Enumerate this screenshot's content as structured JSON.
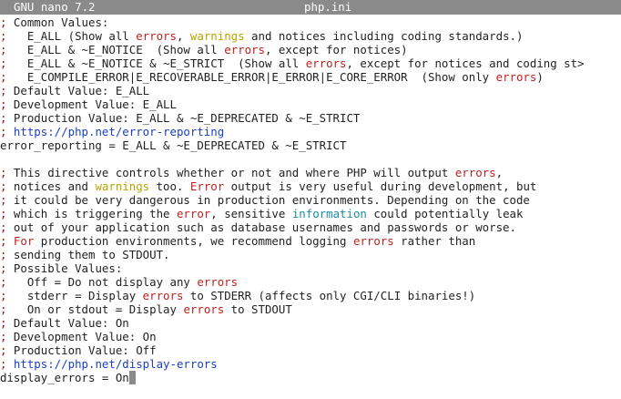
{
  "window": {
    "app_title": "GNU nano 7.2",
    "file_name": "php.ini"
  },
  "colors": {
    "titlebar_bg": "#8a8a8a",
    "comment_marker": "#a00c0c",
    "keyword_red": "#c0201f",
    "keyword_yellow": "#b8a400",
    "keyword_cyan": "#1a8fa0",
    "url_blue": "#1a3fc4"
  },
  "editor": {
    "lines": [
      [
        {
          "t": ";",
          "c": "marker"
        },
        {
          "t": " Common Values:",
          "c": "comment"
        }
      ],
      [
        {
          "t": ";",
          "c": "marker"
        },
        {
          "t": "   E_ALL (Show all ",
          "c": "comment"
        },
        {
          "t": "errors",
          "c": "red"
        },
        {
          "t": ", ",
          "c": "comment"
        },
        {
          "t": "warnings",
          "c": "yellow"
        },
        {
          "t": " and notices including coding standards.)",
          "c": "comment"
        }
      ],
      [
        {
          "t": ";",
          "c": "marker"
        },
        {
          "t": "   E_ALL & ~E_NOTICE  (Show all ",
          "c": "comment"
        },
        {
          "t": "errors",
          "c": "red"
        },
        {
          "t": ", except for notices)",
          "c": "comment"
        }
      ],
      [
        {
          "t": ";",
          "c": "marker"
        },
        {
          "t": "   E_ALL & ~E_NOTICE & ~E_STRICT  (Show all ",
          "c": "comment"
        },
        {
          "t": "errors",
          "c": "red"
        },
        {
          "t": ", except for notices and coding st",
          "c": "comment"
        },
        {
          "t": ">",
          "c": "bar"
        }
      ],
      [
        {
          "t": ";",
          "c": "marker"
        },
        {
          "t": "   E_COMPILE_ERROR|E_RECOVERABLE_ERROR|E_ERROR|E_CORE_ERROR  (Show only ",
          "c": "comment"
        },
        {
          "t": "errors",
          "c": "red"
        },
        {
          "t": ")",
          "c": "comment"
        }
      ],
      [
        {
          "t": ";",
          "c": "marker"
        },
        {
          "t": " Default Value: E_ALL",
          "c": "comment"
        }
      ],
      [
        {
          "t": ";",
          "c": "marker"
        },
        {
          "t": " Development Value: E_ALL",
          "c": "comment"
        }
      ],
      [
        {
          "t": ";",
          "c": "marker"
        },
        {
          "t": " Production Value: E_ALL & ~E_DEPRECATED & ~E_STRICT",
          "c": "comment"
        }
      ],
      [
        {
          "t": ";",
          "c": "marker"
        },
        {
          "t": " https://php.net/error-reporting",
          "c": "blue"
        }
      ],
      [
        {
          "t": "error_reporting = E_ALL & ~E_DEPRECATED & ~E_STRICT",
          "c": "plain"
        }
      ],
      [],
      [
        {
          "t": ";",
          "c": "marker"
        },
        {
          "t": " This directive controls whether or not and where PHP will output ",
          "c": "comment"
        },
        {
          "t": "errors",
          "c": "red"
        },
        {
          "t": ",",
          "c": "comment"
        }
      ],
      [
        {
          "t": ";",
          "c": "marker"
        },
        {
          "t": " notices and ",
          "c": "comment"
        },
        {
          "t": "warnings",
          "c": "yellow"
        },
        {
          "t": " too. ",
          "c": "comment"
        },
        {
          "t": "Error",
          "c": "red"
        },
        {
          "t": " output is very useful during development, but",
          "c": "comment"
        }
      ],
      [
        {
          "t": ";",
          "c": "marker"
        },
        {
          "t": " it could be very dangerous in production environments. Depending on the code",
          "c": "comment"
        }
      ],
      [
        {
          "t": ";",
          "c": "marker"
        },
        {
          "t": " which is triggering the ",
          "c": "comment"
        },
        {
          "t": "error",
          "c": "red"
        },
        {
          "t": ", sensitive ",
          "c": "comment"
        },
        {
          "t": "information",
          "c": "cyan"
        },
        {
          "t": " could potentially leak",
          "c": "comment"
        }
      ],
      [
        {
          "t": ";",
          "c": "marker"
        },
        {
          "t": " out of your application such as database usernames and passwords or worse.",
          "c": "comment"
        }
      ],
      [
        {
          "t": ";",
          "c": "marker"
        },
        {
          "t": " For",
          "c": "red"
        },
        {
          "t": " production environments, we recommend logging ",
          "c": "comment"
        },
        {
          "t": "errors",
          "c": "red"
        },
        {
          "t": " rather than",
          "c": "comment"
        }
      ],
      [
        {
          "t": ";",
          "c": "marker"
        },
        {
          "t": " sending them to STDOUT.",
          "c": "comment"
        }
      ],
      [
        {
          "t": ";",
          "c": "marker"
        },
        {
          "t": " Possible Values:",
          "c": "comment"
        }
      ],
      [
        {
          "t": ";",
          "c": "marker"
        },
        {
          "t": "   Off = Do not display any ",
          "c": "comment"
        },
        {
          "t": "errors",
          "c": "red"
        }
      ],
      [
        {
          "t": ";",
          "c": "marker"
        },
        {
          "t": "   stderr = Display ",
          "c": "comment"
        },
        {
          "t": "errors",
          "c": "red"
        },
        {
          "t": " to STDERR (affects only CGI/CLI binaries!)",
          "c": "comment"
        }
      ],
      [
        {
          "t": ";",
          "c": "marker"
        },
        {
          "t": "   On or stdout = Display ",
          "c": "comment"
        },
        {
          "t": "errors",
          "c": "red"
        },
        {
          "t": " to STDOUT",
          "c": "comment"
        }
      ],
      [
        {
          "t": ";",
          "c": "marker"
        },
        {
          "t": " Default Value: On",
          "c": "comment"
        }
      ],
      [
        {
          "t": ";",
          "c": "marker"
        },
        {
          "t": " Development Value: On",
          "c": "comment"
        }
      ],
      [
        {
          "t": ";",
          "c": "marker"
        },
        {
          "t": " Production Value: Off",
          "c": "comment"
        }
      ],
      [
        {
          "t": ";",
          "c": "marker"
        },
        {
          "t": " https://php.net/display-errors",
          "c": "blue"
        }
      ],
      [
        {
          "t": "display_errors = On",
          "c": "plain"
        },
        {
          "t": " ",
          "c": "cursor"
        }
      ]
    ]
  }
}
